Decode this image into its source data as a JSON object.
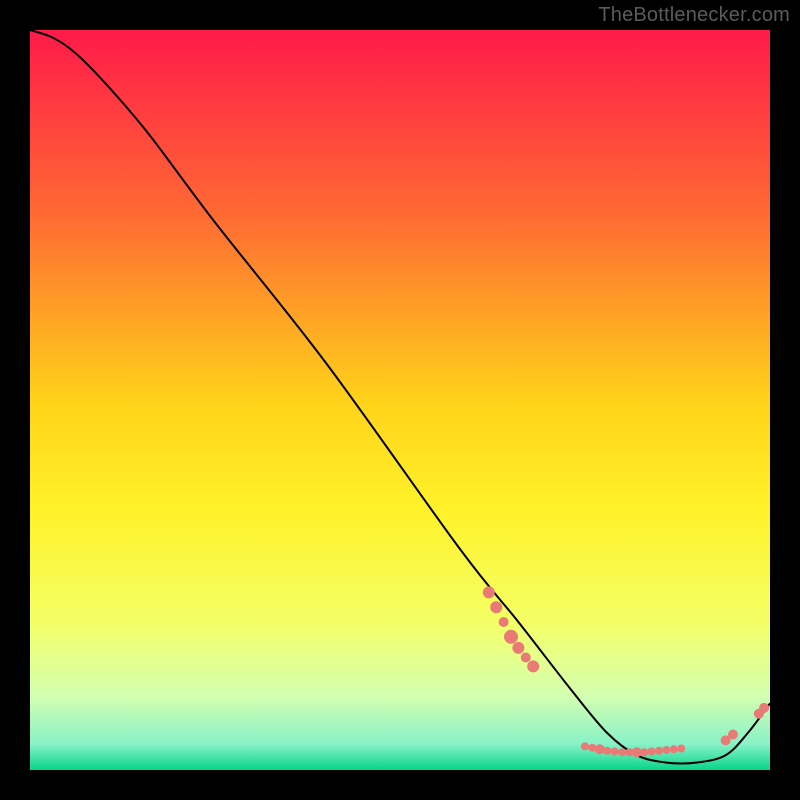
{
  "attribution": "TheBottlenecker.com",
  "chart_data": {
    "type": "line",
    "title": "",
    "xlabel": "",
    "ylabel": "",
    "xlim": [
      0,
      100
    ],
    "ylim": [
      0,
      100
    ],
    "background_gradient_stops": [
      {
        "offset": 0.0,
        "color": "#ff1a4a"
      },
      {
        "offset": 0.25,
        "color": "#ff6a33"
      },
      {
        "offset": 0.5,
        "color": "#ffd21a"
      },
      {
        "offset": 0.65,
        "color": "#fff22a"
      },
      {
        "offset": 0.8,
        "color": "#f4ff66"
      },
      {
        "offset": 0.9,
        "color": "#d4ffb0"
      },
      {
        "offset": 0.965,
        "color": "#88f2c8"
      },
      {
        "offset": 1.0,
        "color": "#08d48a"
      }
    ],
    "series": [
      {
        "name": "bottleneck-curve",
        "stroke": "#000000",
        "x": [
          0,
          3,
          6,
          10,
          16,
          25,
          40,
          58,
          66,
          73,
          78,
          82,
          86,
          90,
          94,
          97,
          100
        ],
        "y": [
          100,
          99,
          97,
          93,
          86,
          74,
          55,
          30,
          20,
          11,
          5,
          2,
          1,
          1,
          2,
          5,
          9
        ]
      }
    ],
    "markers": [
      {
        "x": 62,
        "y": 24,
        "r": 6,
        "color": "#e97a76"
      },
      {
        "x": 63,
        "y": 22,
        "r": 6,
        "color": "#e97a76"
      },
      {
        "x": 64,
        "y": 20,
        "r": 5,
        "color": "#e97a76"
      },
      {
        "x": 65,
        "y": 18,
        "r": 7,
        "color": "#e97a76"
      },
      {
        "x": 66,
        "y": 16.5,
        "r": 6,
        "color": "#e97a76"
      },
      {
        "x": 67,
        "y": 15.2,
        "r": 5,
        "color": "#e97a76"
      },
      {
        "x": 68,
        "y": 14,
        "r": 6,
        "color": "#e97a76"
      },
      {
        "x": 75,
        "y": 3.2,
        "r": 4,
        "color": "#e97a76"
      },
      {
        "x": 76,
        "y": 3.0,
        "r": 4,
        "color": "#e97a76"
      },
      {
        "x": 77,
        "y": 2.8,
        "r": 5,
        "color": "#e97a76"
      },
      {
        "x": 78,
        "y": 2.6,
        "r": 4,
        "color": "#e97a76"
      },
      {
        "x": 79,
        "y": 2.5,
        "r": 4,
        "color": "#e97a76"
      },
      {
        "x": 80,
        "y": 2.4,
        "r": 4,
        "color": "#e97a76"
      },
      {
        "x": 81,
        "y": 2.4,
        "r": 4,
        "color": "#e97a76"
      },
      {
        "x": 82,
        "y": 2.4,
        "r": 5,
        "color": "#e97a76"
      },
      {
        "x": 83,
        "y": 2.4,
        "r": 4,
        "color": "#e97a76"
      },
      {
        "x": 84,
        "y": 2.5,
        "r": 4,
        "color": "#e97a76"
      },
      {
        "x": 85,
        "y": 2.6,
        "r": 4,
        "color": "#e97a76"
      },
      {
        "x": 86,
        "y": 2.7,
        "r": 4,
        "color": "#e97a76"
      },
      {
        "x": 87,
        "y": 2.8,
        "r": 4,
        "color": "#e97a76"
      },
      {
        "x": 88,
        "y": 2.9,
        "r": 4,
        "color": "#e97a76"
      },
      {
        "x": 94,
        "y": 4.0,
        "r": 5,
        "color": "#e97a76"
      },
      {
        "x": 95,
        "y": 4.8,
        "r": 5,
        "color": "#e97a76"
      },
      {
        "x": 98.5,
        "y": 7.6,
        "r": 5,
        "color": "#e97a76"
      },
      {
        "x": 99.2,
        "y": 8.4,
        "r": 5,
        "color": "#e97a76"
      }
    ]
  }
}
